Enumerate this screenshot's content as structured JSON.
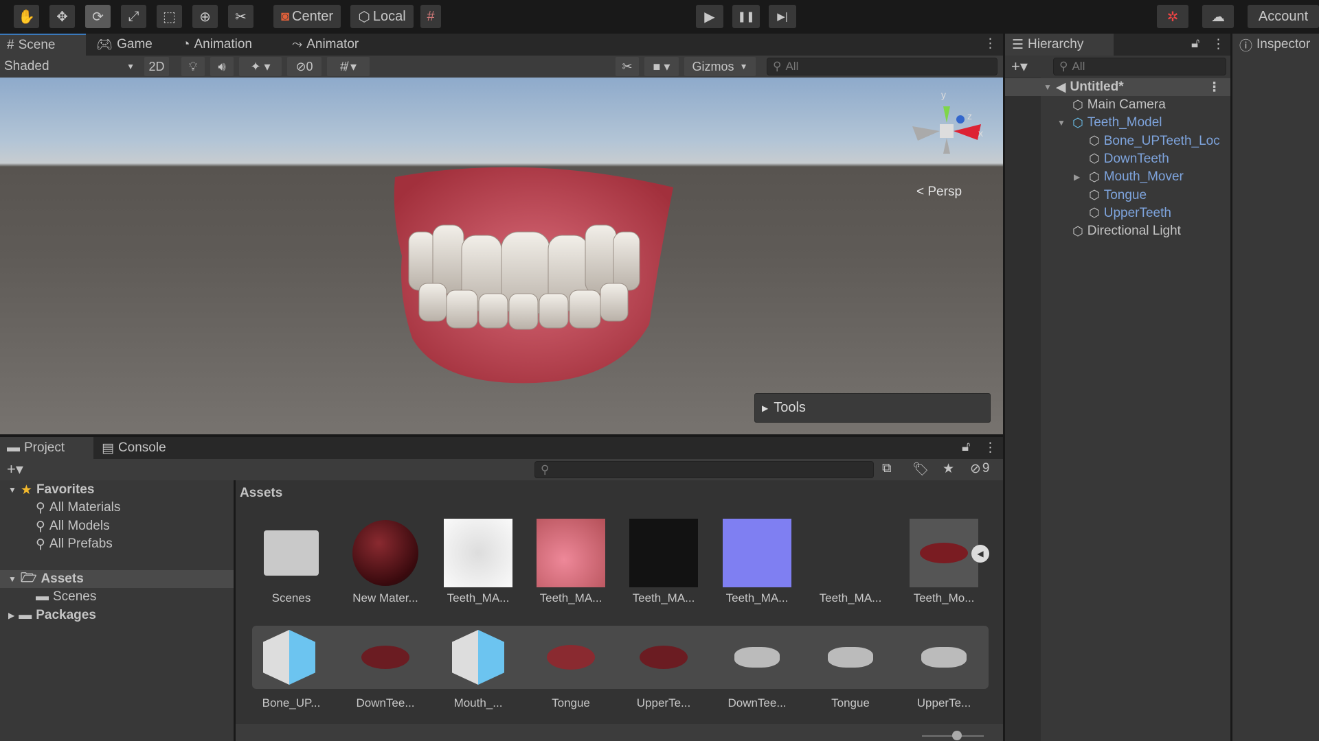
{
  "toolbar": {
    "tools": [
      {
        "icon": "hand-icon"
      },
      {
        "icon": "move-icon"
      },
      {
        "icon": "rotate-icon",
        "active": true
      },
      {
        "icon": "scale-icon"
      },
      {
        "icon": "rect-icon"
      },
      {
        "icon": "transform-icon"
      },
      {
        "icon": "custom-tool-icon"
      }
    ],
    "pivot_label": "Center",
    "space_label": "Local",
    "play": "▶",
    "pause": "❚❚",
    "step": "▶|",
    "account_label": "Account"
  },
  "scene_tabs": [
    {
      "label": "Scene",
      "icon": "#",
      "active": true
    },
    {
      "label": "Game",
      "icon": "gamepad-icon"
    },
    {
      "label": "Animation",
      "icon": "clock-icon"
    },
    {
      "label": "Animator",
      "icon": "animator-icon"
    }
  ],
  "scene_toolbar": {
    "shading": "Shaded",
    "mode_2d": "2D",
    "hidden_count": "0",
    "gizmos": "Gizmos",
    "search_placeholder": "All"
  },
  "scene_view": {
    "projection_label": "< Persp",
    "tools_overlay": "Tools",
    "gizmo_axes": {
      "y": "y",
      "z": "z",
      "x": "x"
    }
  },
  "hierarchy": {
    "tab": "Hierarchy",
    "search_placeholder": "All",
    "scene_name": "Untitled*",
    "items": [
      {
        "label": "Main Camera",
        "depth": 1,
        "prefab": false
      },
      {
        "label": "Teeth_Model",
        "depth": 1,
        "prefab": true,
        "expanded": true
      },
      {
        "label": "Bone_UPTeeth_Loc",
        "depth": 2,
        "prefab": true
      },
      {
        "label": "DownTeeth",
        "depth": 2,
        "prefab": true
      },
      {
        "label": "Mouth_Mover",
        "depth": 2,
        "prefab": true,
        "collapsed": true
      },
      {
        "label": "Tongue",
        "depth": 2,
        "prefab": true
      },
      {
        "label": "UpperTeeth",
        "depth": 2,
        "prefab": true
      },
      {
        "label": "Directional Light",
        "depth": 1,
        "prefab": false
      }
    ]
  },
  "inspector": {
    "tab": "Inspector"
  },
  "project": {
    "tabs": [
      {
        "label": "Project"
      },
      {
        "label": "Console"
      }
    ],
    "hidden_count": "9",
    "tree": {
      "favorites": "Favorites",
      "fav_items": [
        "All Materials",
        "All Models",
        "All Prefabs"
      ],
      "assets": "Assets",
      "asset_items": [
        "Scenes"
      ],
      "packages": "Packages"
    },
    "breadcrumb": "Assets",
    "row1": [
      "Scenes",
      "New Mater...",
      "Teeth_MA...",
      "Teeth_MA...",
      "Teeth_MA...",
      "Teeth_MA...",
      "Teeth_MA...",
      "Teeth_Mo..."
    ],
    "row2": [
      "Bone_UP...",
      "DownTee...",
      "Mouth_...",
      "Tongue",
      "UpperTe...",
      "DownTee...",
      "Tongue",
      "UpperTe..."
    ]
  },
  "colors": {
    "accent": "#3a79bb",
    "prefab_text": "#7ea4dd",
    "panel": "#383838"
  }
}
